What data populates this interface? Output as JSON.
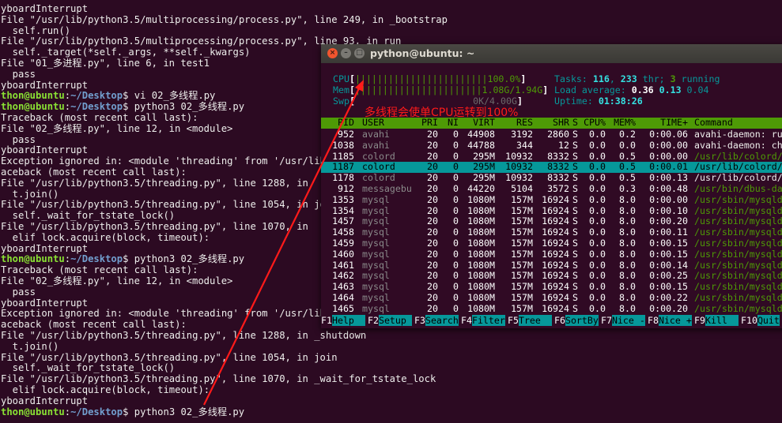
{
  "terminal_lines": [
    "yboardInterrupt",
    "File \"/usr/lib/python3.5/multiprocessing/process.py\", line 249, in _bootstrap",
    "  self.run()",
    "File \"/usr/lib/python3.5/multiprocessing/process.py\", line 93, in run",
    "  self._target(*self._args, **self._kwargs)",
    "File \"01_多进程.py\", line 6, in test1",
    "  pass",
    "yboardInterrupt",
    "",
    "",
    "Traceback (most recent call last):",
    "File \"02_多线程.py\", line 12, in <module>",
    "  pass",
    "yboardInterrupt",
    "Exception ignored in: <module 'threading' from '/usr/lib",
    "aceback (most recent call last):",
    "File \"/usr/lib/python3.5/threading.py\", line 1288, in",
    "  t.join()",
    "File \"/usr/lib/python3.5/threading.py\", line 1054, in jo",
    "  self._wait_for_tstate_lock()",
    "File \"/usr/lib/python3.5/threading.py\", line 1070, in",
    "  elif lock.acquire(block, timeout):",
    "yboardInterrupt",
    "",
    "Traceback (most recent call last):",
    "File \"02_多线程.py\", line 12, in <module>",
    "  pass",
    "yboardInterrupt",
    "Exception ignored in: <module 'threading' from '/usr/lib",
    "aceback (most recent call last):",
    "File \"/usr/lib/python3.5/threading.py\", line 1288, in _shutdown",
    "  t.join()",
    "File \"/usr/lib/python3.5/threading.py\", line 1054, in join",
    "  self._wait_for_tstate_lock()",
    "File \"/usr/lib/python3.5/threading.py\", line 1070, in _wait_for_tstate_lock",
    "  elif lock.acquire(block, timeout):",
    "yboardInterrupt",
    ""
  ],
  "prompts": {
    "user": "thon@ubuntu",
    "path": "~/Desktop",
    "cmd1": " vi 02_多线程.py",
    "cmd2": " python3 02_多线程.py",
    "cmd3": " python3 02_多线程.py",
    "cmd4": " python3 02_多线程.py"
  },
  "window": {
    "title": "python@ubuntu: ~",
    "close": "×",
    "min": "–",
    "max": "□"
  },
  "meters": {
    "cpu_label": "CPU",
    "cpu_bar": "||||||||||||||||||||||||100.0%",
    "mem_label": "Mem",
    "mem_bar": "|||||||||||||||||||||||1.08G/1.94G",
    "swp_label": "Swp",
    "swp_bar": "0K/4.00G",
    "tasks_label": "Tasks: ",
    "tasks": "116",
    "thr": "233",
    "thr_label": " thr; ",
    "running": "3",
    "running_label": " running",
    "load_label": "Load average: ",
    "load1": "0.36",
    "load5": "0.13",
    "load15": "0.04",
    "uptime_label": "Uptime: ",
    "uptime": "01:38:26"
  },
  "columns": [
    "PID",
    "USER",
    "PRI",
    "NI",
    "VIRT",
    "RES",
    "SHR",
    "S",
    "CPU%",
    "MEM%",
    "TIME+",
    "Command"
  ],
  "processes": [
    [
      "952",
      "avahi",
      "20",
      "0",
      "44908",
      "3192",
      "2860",
      "S",
      "0.0",
      "0.2",
      "0:00.06",
      "avahi-daemon: ru"
    ],
    [
      "1038",
      "avahi",
      "20",
      "0",
      "44788",
      "344",
      "12",
      "S",
      "0.0",
      "0.0",
      "0:00.00",
      "avahi-daemon: ch"
    ],
    [
      "1185",
      "colord",
      "20",
      "0",
      "295M",
      "10932",
      "8332",
      "S",
      "0.0",
      "0.5",
      "0:00.00",
      "/usr/lib/colord/"
    ],
    [
      "1187",
      "colord",
      "20",
      "0",
      "295M",
      "10932",
      "8332",
      "S",
      "0.0",
      "0.5",
      "0:00.01",
      "/usr/lib/colord/"
    ],
    [
      "1178",
      "colord",
      "20",
      "0",
      "295M",
      "10932",
      "8332",
      "S",
      "0.0",
      "0.5",
      "0:00.13",
      "/usr/lib/colord/"
    ],
    [
      "912",
      "messagebu",
      "20",
      "0",
      "44220",
      "5104",
      "3572",
      "S",
      "0.0",
      "0.3",
      "0:00.48",
      "/usr/bin/dbus-da"
    ],
    [
      "1353",
      "mysql",
      "20",
      "0",
      "1080M",
      "157M",
      "16924",
      "S",
      "0.0",
      "8.0",
      "0:00.00",
      "/usr/sbin/mysqld"
    ],
    [
      "1354",
      "mysql",
      "20",
      "0",
      "1080M",
      "157M",
      "16924",
      "S",
      "0.0",
      "8.0",
      "0:00.10",
      "/usr/sbin/mysqld"
    ],
    [
      "1457",
      "mysql",
      "20",
      "0",
      "1080M",
      "157M",
      "16924",
      "S",
      "0.0",
      "8.0",
      "0:00.20",
      "/usr/sbin/mysqld"
    ],
    [
      "1458",
      "mysql",
      "20",
      "0",
      "1080M",
      "157M",
      "16924",
      "S",
      "0.0",
      "8.0",
      "0:00.11",
      "/usr/sbin/mysqld"
    ],
    [
      "1459",
      "mysql",
      "20",
      "0",
      "1080M",
      "157M",
      "16924",
      "S",
      "0.0",
      "8.0",
      "0:00.15",
      "/usr/sbin/mysqld"
    ],
    [
      "1460",
      "mysql",
      "20",
      "0",
      "1080M",
      "157M",
      "16924",
      "S",
      "0.0",
      "8.0",
      "0:00.15",
      "/usr/sbin/mysqld"
    ],
    [
      "1461",
      "mysql",
      "20",
      "0",
      "1080M",
      "157M",
      "16924",
      "S",
      "0.0",
      "8.0",
      "0:00.14",
      "/usr/sbin/mysqld"
    ],
    [
      "1462",
      "mysql",
      "20",
      "0",
      "1080M",
      "157M",
      "16924",
      "S",
      "0.0",
      "8.0",
      "0:00.25",
      "/usr/sbin/mysqld"
    ],
    [
      "1463",
      "mysql",
      "20",
      "0",
      "1080M",
      "157M",
      "16924",
      "S",
      "0.0",
      "8.0",
      "0:00.15",
      "/usr/sbin/mysqld"
    ],
    [
      "1464",
      "mysql",
      "20",
      "0",
      "1080M",
      "157M",
      "16924",
      "S",
      "0.0",
      "8.0",
      "0:00.22",
      "/usr/sbin/mysqld"
    ],
    [
      "1465",
      "mysql",
      "20",
      "0",
      "1080M",
      "157M",
      "16924",
      "S",
      "0.0",
      "8.0",
      "0:00.20",
      "/usr/sbin/mysqld"
    ]
  ],
  "selected_row": 3,
  "fkeys": [
    {
      "key": "F1",
      "label": "Help  "
    },
    {
      "key": "F2",
      "label": "Setup "
    },
    {
      "key": "F3",
      "label": "Search"
    },
    {
      "key": "F4",
      "label": "Filter"
    },
    {
      "key": "F5",
      "label": "Tree  "
    },
    {
      "key": "F6",
      "label": "SortBy"
    },
    {
      "key": "F7",
      "label": "Nice -"
    },
    {
      "key": "F8",
      "label": "Nice +"
    },
    {
      "key": "F9",
      "label": "Kill  "
    },
    {
      "key": "F10",
      "label": "Quit"
    }
  ],
  "annotation": "多线程会使单CPU运转到100%",
  "colors": {
    "annotation": "#ff1a1a",
    "terminal_bg": "#2c0a22",
    "prompt_user": "#8ae234",
    "prompt_path": "#729fcf",
    "htop_cyan": "#06989a",
    "htop_green": "#4e9a06"
  }
}
